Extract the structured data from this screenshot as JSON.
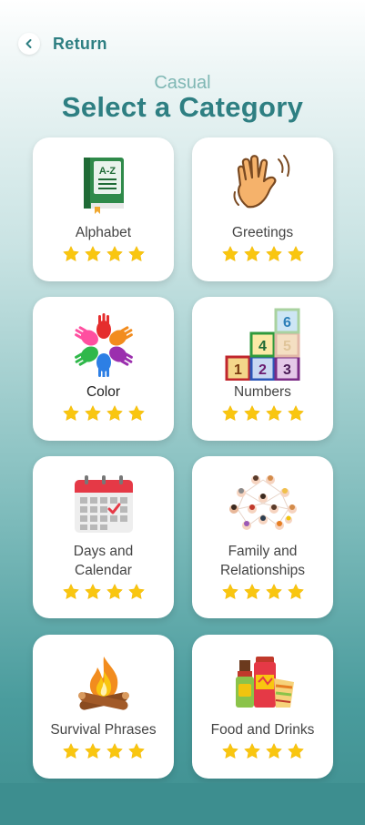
{
  "header": {
    "return_label": "Return",
    "subtitle": "Casual",
    "title": "Select a Category"
  },
  "colors": {
    "accent": "#2e7f82",
    "star": "#f9c610",
    "card_bg": "#ffffff"
  },
  "categories": [
    {
      "label": "Alphabet",
      "icon": "book-icon",
      "book_text": "A-Z",
      "stars": 4
    },
    {
      "label": "Greetings",
      "icon": "waving-hand-icon",
      "stars": 4
    },
    {
      "label": "Color",
      "icon": "colorful-hands-icon",
      "stars": 4
    },
    {
      "label": "Numbers",
      "icon": "number-blocks-icon",
      "block_digits": [
        "1",
        "2",
        "3",
        "4",
        "5",
        "6"
      ],
      "stars": 4
    },
    {
      "label": "Days and Calendar",
      "icon": "calendar-icon",
      "stars": 4
    },
    {
      "label": "Family and Relationships",
      "icon": "family-network-icon",
      "stars": 4
    },
    {
      "label": "Survival Phrases",
      "icon": "campfire-icon",
      "stars": 4
    },
    {
      "label": "Food and Drinks",
      "icon": "snacks-icon",
      "stars": 4
    }
  ]
}
